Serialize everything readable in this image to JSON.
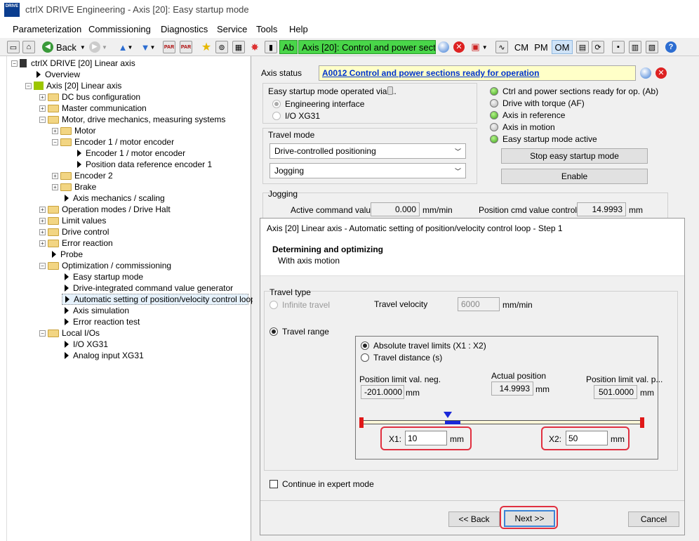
{
  "window": {
    "title": "ctrlX DRIVE Engineering - Axis [20]: Easy startup mode",
    "icon_text": "DRIVE"
  },
  "menu": [
    "Parameterization",
    "Commissioning",
    "Diagnostics",
    "Service",
    "Tools",
    "Help"
  ],
  "toolbar": {
    "back_label": "Back",
    "status_short": "Ab",
    "status_text": "Axis [20]:   Control and power sectio",
    "cm": "CM",
    "pm": "PM",
    "om": "OM"
  },
  "tree": {
    "root": "ctrlX DRIVE [20] Linear axis",
    "items": [
      "Overview",
      "Axis [20] Linear axis",
      "DC bus configuration",
      "Master communication",
      "Motor, drive mechanics, measuring systems",
      "Motor",
      "Encoder 1 / motor encoder",
      "Encoder 1 / motor encoder",
      "Position data reference encoder 1",
      "Encoder 2",
      "Brake",
      "Axis mechanics / scaling",
      "Operation modes / Drive Halt",
      "Limit values",
      "Drive control",
      "Error reaction",
      "Probe",
      "Optimization / commissioning",
      "Easy startup mode",
      "Drive-integrated command value generator",
      "Automatic setting of position/velocity control loop...",
      "Axis simulation",
      "Error reaction test",
      "Local I/Os",
      "I/O XG31",
      "Analog input XG31"
    ]
  },
  "axis_status": {
    "label": "Axis status",
    "value": "A0012 Control and power sections ready for operation"
  },
  "easy_startup": {
    "title": "Easy startup mode operated via ...",
    "options": [
      "Engineering interface",
      "I/O XG31"
    ]
  },
  "status_leds": [
    {
      "label": "Ctrl and power sections ready for op. (Ab)",
      "color": "#3fa51a"
    },
    {
      "label": "Drive with torque (AF)",
      "color": "#b5b5b5"
    },
    {
      "label": "Axis in reference",
      "color": "#3fa51a"
    },
    {
      "label": "Axis in motion",
      "color": "#b5b5b5"
    },
    {
      "label": "Easy startup mode active",
      "color": "#3fa51a"
    }
  ],
  "travel_mode": {
    "title": "Travel mode",
    "mode": "Drive-controlled positioning",
    "sub": "Jogging"
  },
  "buttons": {
    "stop": "Stop easy startup mode",
    "enable": "Enable"
  },
  "jogging": {
    "title": "Jogging",
    "active_cmd_label": "Active command value",
    "active_cmd_value": "0.000",
    "active_cmd_unit": "mm/min",
    "pos_cmd_label": "Position cmd value controller",
    "pos_cmd_value": "14.9993",
    "pos_cmd_unit": "mm"
  },
  "dialog": {
    "title": "Axis [20] Linear axis - Automatic setting of position/velocity control loop - Step 1",
    "heading": "Determining and optimizing",
    "subheading": "With axis motion",
    "travel_type": "Travel type",
    "infinite_travel": "Infinite travel",
    "travel_velocity_label": "Travel velocity",
    "travel_velocity_value": "6000",
    "travel_velocity_unit": "mm/min",
    "travel_range": "Travel range",
    "abs_limits": "Absolute travel limits (X1 : X2)",
    "travel_distance": "Travel distance (s)",
    "pos_neg_label": "Position limit val. neg.",
    "pos_neg_value": "-201.0000",
    "actual_label": "Actual position",
    "actual_value": "14.9993",
    "pos_pos_label": "Position limit val. p...",
    "pos_pos_value": "501.0000",
    "unit_mm": "mm",
    "x1_label": "X1:",
    "x1_value": "10",
    "x2_label": "X2:",
    "x2_value": "50",
    "expert_mode": "Continue in expert mode",
    "back": "<< Back",
    "next": "Next >>",
    "cancel": "Cancel"
  }
}
